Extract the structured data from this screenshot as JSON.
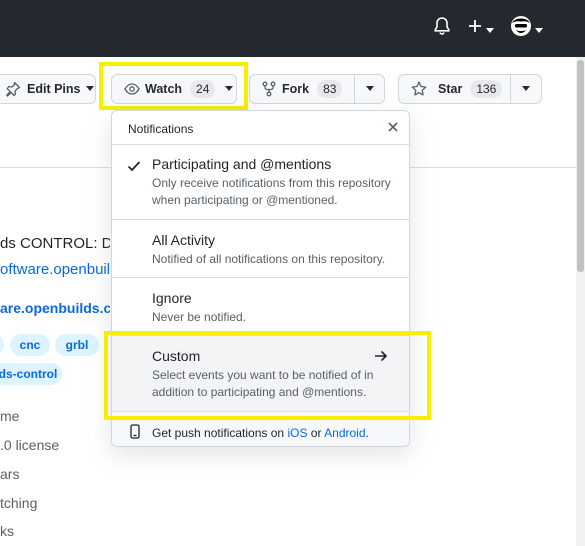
{
  "header": {
    "icons": [
      "bell-icon",
      "plus-icon",
      "avatar"
    ]
  },
  "actions": {
    "edit_pins_label": "Edit Pins",
    "watch_label": "Watch",
    "watch_count": "24",
    "fork_label": "Fork",
    "fork_count": "83",
    "star_label": "Star",
    "star_count": "136"
  },
  "sidebar": {
    "about_line": "ds CONTROL: D",
    "website_line": "oftware.openbuil",
    "website_bold": "are.openbuilds.co",
    "topics": [
      "cnc",
      "grbl",
      "ds-control"
    ],
    "meta": [
      "me",
      ".0 license",
      "ars",
      "tching",
      "ks"
    ]
  },
  "notifications": {
    "title": "Notifications",
    "options": [
      {
        "title": "Participating and @mentions",
        "desc": "Only receive notifications from this repository when participating or @mentioned.",
        "selected": true
      },
      {
        "title": "All Activity",
        "desc": "Notified of all notifications on this repository.",
        "selected": false
      },
      {
        "title": "Ignore",
        "desc": "Never be notified.",
        "selected": false
      },
      {
        "title": "Custom",
        "desc": "Select events you want to be notified of in addition to participating and @mentions.",
        "selected": false
      }
    ],
    "footer": {
      "prefix": "Get push notifications on",
      "ios": "iOS",
      "or": "or",
      "android": "Android",
      "suffix": "."
    }
  },
  "colors": {
    "highlight": "#f5ef00",
    "header_bg": "#24292f",
    "link": "#0969da",
    "topic_bg": "#ddf4ff"
  }
}
